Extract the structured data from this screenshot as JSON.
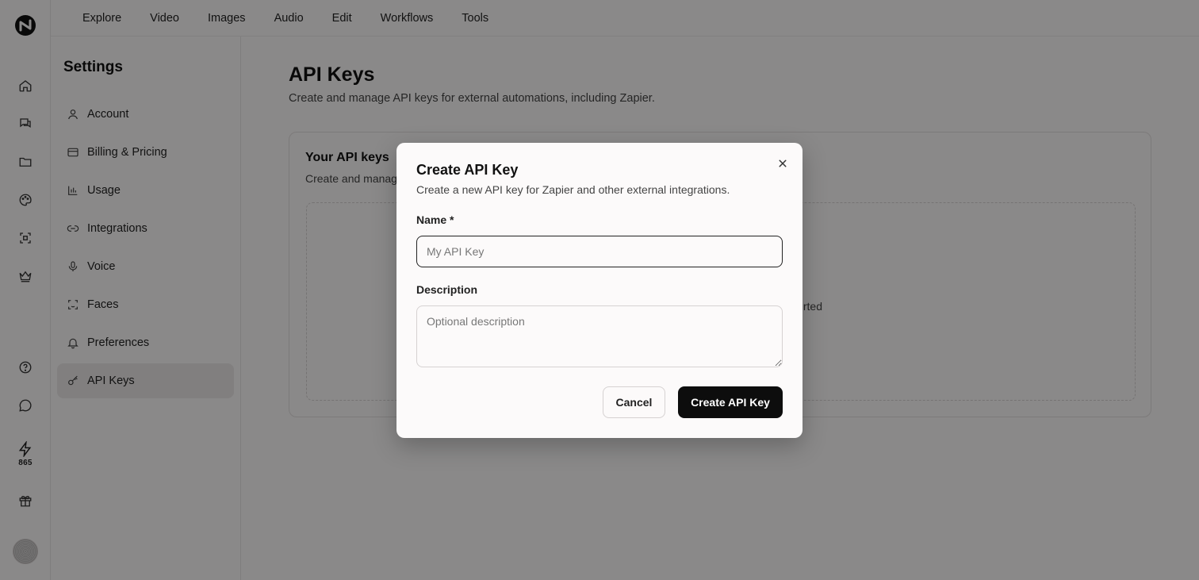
{
  "topnav": [
    "Explore",
    "Video",
    "Images",
    "Audio",
    "Edit",
    "Workflows",
    "Tools"
  ],
  "rail": {
    "credits": "865"
  },
  "settings": {
    "title": "Settings",
    "items": [
      {
        "label": "Account",
        "icon": "user-icon"
      },
      {
        "label": "Billing & Pricing",
        "icon": "credit-card-icon"
      },
      {
        "label": "Usage",
        "icon": "bar-chart-icon"
      },
      {
        "label": "Integrations",
        "icon": "link-icon"
      },
      {
        "label": "Voice",
        "icon": "microphone-icon"
      },
      {
        "label": "Faces",
        "icon": "face-scan-icon"
      },
      {
        "label": "Preferences",
        "icon": "bell-icon"
      },
      {
        "label": "API Keys",
        "icon": "key-icon"
      }
    ]
  },
  "main": {
    "title": "API Keys",
    "subtitle": "Create and manage API keys for external automations, including Zapier.",
    "card_title": "Your API keys",
    "card_subtitle": "Create and manag",
    "empty_fragment": "rted"
  },
  "modal": {
    "title": "Create API Key",
    "subtitle": "Create a new API key for Zapier and other external integrations.",
    "name_label": "Name *",
    "name_placeholder": "My API Key",
    "description_label": "Description",
    "description_placeholder": "Optional description",
    "cancel_label": "Cancel",
    "create_label": "Create API Key"
  }
}
